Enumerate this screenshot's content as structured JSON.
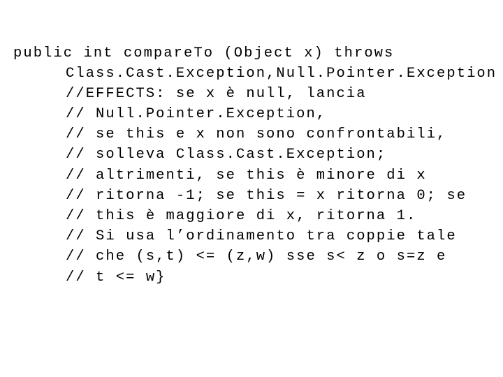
{
  "document": {
    "type": "code-slide",
    "language": "java",
    "background_color": "#ffffff",
    "text_color": "#000000",
    "code": {
      "lines": [
        {
          "indent": 0,
          "text": "public int compareTo (Object x) throws"
        },
        {
          "indent": 1,
          "text": "Class.Cast.Exception,Null.Pointer.Exception {"
        },
        {
          "indent": 1,
          "text": "//EFFECTS: se x è null, lancia"
        },
        {
          "indent": 1,
          "text": "// Null.Pointer.Exception,"
        },
        {
          "indent": 1,
          "text": "// se this e x non sono confrontabili,"
        },
        {
          "indent": 1,
          "text": "// solleva Class.Cast.Exception;"
        },
        {
          "indent": 1,
          "text": "// altrimenti, se this è minore di x"
        },
        {
          "indent": 1,
          "text": "// ritorna -1; se this = x ritorna 0; se"
        },
        {
          "indent": 1,
          "text": "// this è maggiore di x, ritorna 1."
        },
        {
          "indent": 1,
          "text": "// Si usa l’ordinamento tra coppie tale"
        },
        {
          "indent": 1,
          "text": "// che (s,t) <= (z,w) sse s< z o s=z e"
        },
        {
          "indent": 1,
          "text": "// t <= w}"
        }
      ]
    }
  }
}
